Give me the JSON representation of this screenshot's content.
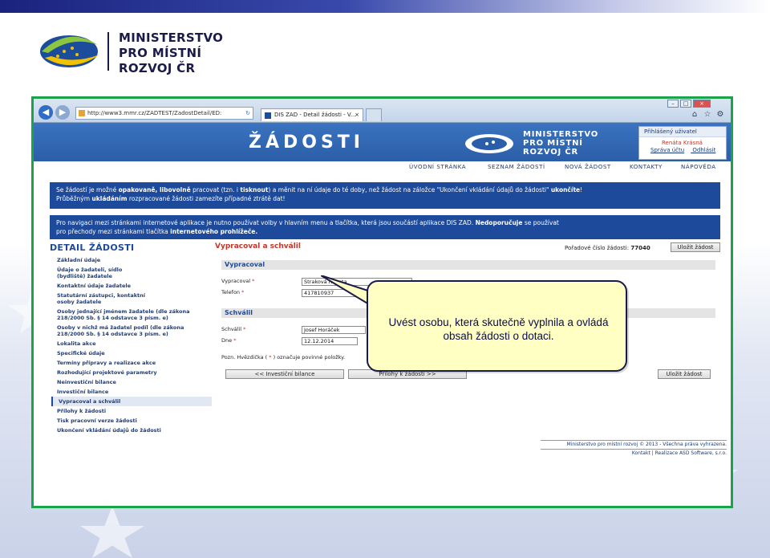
{
  "slide": {
    "ministry_line1": "MINISTERSTVO",
    "ministry_line2": "PRO MÍSTNÍ",
    "ministry_line3": "ROZVOJ ČR",
    "accent_color": "#1aa34a"
  },
  "browser": {
    "address": "http://www3.mmr.cz/ZADTEST/ZadostDetail/ED: ",
    "tab_title": "DIS ZAD - Detail žádosti - V...",
    "icons": [
      "back-icon",
      "forward-icon",
      "refresh-icon",
      "home-icon",
      "star-icon",
      "gear-icon"
    ]
  },
  "app": {
    "title": "ŽÁDOSTI",
    "ministry_line1": "MINISTERSTVO",
    "ministry_line2": "PRO MÍSTNÍ",
    "ministry_line3": "ROZVOJ ČR",
    "user_box": {
      "header": "Přihlášený uživatel",
      "name": "Renáta Krásná",
      "account_link": "Správa účtu",
      "logout_link": "Odhlásit"
    },
    "menu": [
      "ÚVODNÍ STRÁNKA",
      "SEZNAM ŽÁDOSTÍ",
      "NOVÁ ŽÁDOST",
      "KONTAKTY",
      "NÁPOVĚDA"
    ],
    "info1": {
      "p1": "Se žádostí je možné ",
      "p2": "opakovaně, libovolně",
      "p3": " pracovat (tzn. i ",
      "p4": "tisknout",
      "p5": ") a měnit na ní údaje do té doby, než žádost na záložce \"Ukončení vkládání údajů do žádosti\" ",
      "p6": "ukončíte",
      "p7": "!",
      "p8": "Průběžným ",
      "p9": "ukládáním",
      "p10": " rozpracované žádosti zamezíte případné ztrátě dat!"
    },
    "info2": {
      "p1": "Pro navigaci mezi stránkami internetové aplikace je nutno používat volby v hlavním menu a tlačítka, která jsou součástí aplikace DIS ZAD. ",
      "p2": "Nedoporučuje",
      "p3": " se používat",
      "p4": "pro přechody mezi stránkami tlačítka ",
      "p5": "internetového prohlížeče."
    },
    "detail_title": "DETAIL ŽÁDOSTI",
    "nav": [
      "Základní údaje",
      "Údaje o žadateli, sídlo (bydliště) žadatele",
      "Kontaktní údaje žadatele",
      "Statutární zástupci, kontaktní osoby žadatele",
      "Osoby jednající jménem žadatele (dle zákona 218/2000 Sb. § 14 odstavce 3 písm. e)",
      "Osoby v nichž má žadatel podíl (dle zákona 218/2000 Sb. § 14 odstavce 3 písm. e)",
      "Lokalita akce",
      "Specifické údaje",
      "Termíny přípravy a realizace akce",
      "Rozhodující projektové parametry",
      "Neinvestiční bilance",
      "Investiční bilance",
      "Vypracoval a schválil",
      "Přílohy k žádosti",
      "Tisk pracovní verze žádosti",
      "Ukončení vkládání údajů do žádosti"
    ],
    "form": {
      "title": "Vypracoval a schválil",
      "order_label": "Pořadové číslo žádosti:",
      "order_number": "77040",
      "save_label": "Uložit žádost",
      "section1": "Vypracoval",
      "prepared_by_label": "Vypracoval",
      "prepared_by_value": "Straková Renata",
      "phone_label": "Telefon",
      "phone_value": "417810937",
      "section2": "Schválil",
      "approved_by_label": "Schválil",
      "approved_by_value": "Josef Horáček",
      "date_label": "Dne",
      "date_value": "12.12.2014",
      "required_mark": "*",
      "note_a": "Pozn. Hvězdička ( ",
      "note_b": "*",
      "note_c": " ) označuje povinné položky.",
      "prev_button": "<< Investiční bilance",
      "next_button": "Přílohy k žádosti >>"
    },
    "footer": {
      "copyright": "Ministerstvo pro místní rozvoj © 2013 - Všechna práva vyhrazena.",
      "links": "Kontakt | Realizace ASD Software, s.r.o."
    }
  },
  "callout": {
    "line1": "Uvést osobu, která skutečně vyplnila a ovládá",
    "line2": "obsah žádosti o dotaci."
  }
}
